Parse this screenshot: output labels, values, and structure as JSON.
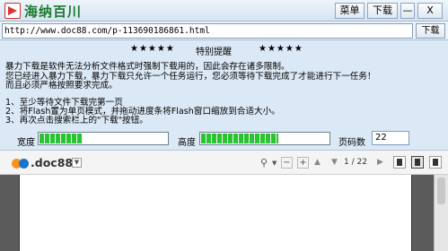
{
  "window": {
    "title": "海纳百川",
    "menu_label": "菜单",
    "download_label": "下载",
    "minimize_label": "—",
    "close_label": "X"
  },
  "address": {
    "url": "http://www.doc88.com/p-113690186861.html",
    "download_label": "下载"
  },
  "notice": {
    "stars_left": "★★★★★",
    "title": "特别提醒",
    "stars_right": "★★★★★",
    "paragraphs": [
      "暴力下载是软件无法分析文件格式时强制下载用的，因此会存在诸多限制。",
      "您已经进入暴力下载，暴力下载只允许一个任务运行，您必须等待下载完成了才能进行下一任务！",
      "而且必须严格按照要求完成。"
    ],
    "steps": [
      "1、至少等待文件下载完第一页",
      "2、将Flash置为单页模式，并拖动进度条将Flash窗口缩放到合适大小。",
      "3、再次点击搜索栏上的\"下载\"按钮。"
    ]
  },
  "controls": {
    "width_label": "宽度",
    "width_fill": 0.33,
    "height_label": "高度",
    "height_fill": 0.6,
    "pages_label": "页码数",
    "pages_value": "22"
  },
  "viewer": {
    "logo_text": ".doc88",
    "page_indicator": "1 / 22",
    "icons": [
      "search-icon",
      "zoom-out-icon",
      "zoom-in-icon",
      "page-up-icon",
      "page-down-icon"
    ]
  }
}
